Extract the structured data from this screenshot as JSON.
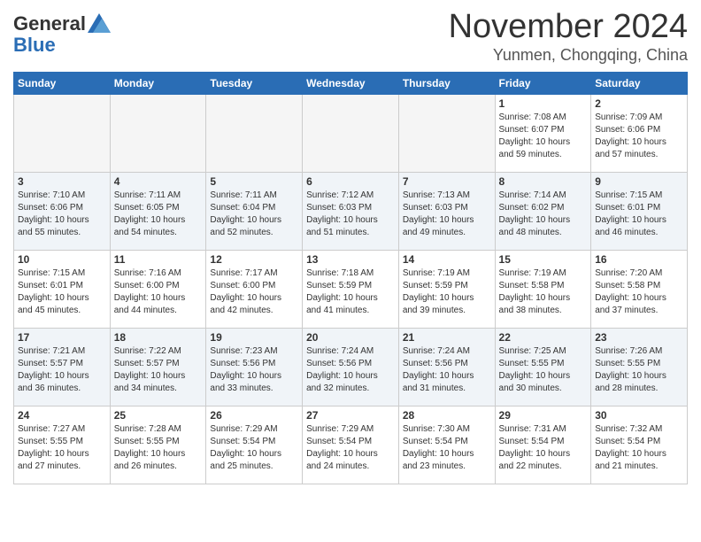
{
  "header": {
    "logo_general": "General",
    "logo_blue": "Blue",
    "month": "November 2024",
    "location": "Yunmen, Chongqing, China"
  },
  "weekdays": [
    "Sunday",
    "Monday",
    "Tuesday",
    "Wednesday",
    "Thursday",
    "Friday",
    "Saturday"
  ],
  "weeks": [
    [
      {
        "day": "",
        "info": ""
      },
      {
        "day": "",
        "info": ""
      },
      {
        "day": "",
        "info": ""
      },
      {
        "day": "",
        "info": ""
      },
      {
        "day": "",
        "info": ""
      },
      {
        "day": "1",
        "info": "Sunrise: 7:08 AM\nSunset: 6:07 PM\nDaylight: 10 hours\nand 59 minutes."
      },
      {
        "day": "2",
        "info": "Sunrise: 7:09 AM\nSunset: 6:06 PM\nDaylight: 10 hours\nand 57 minutes."
      }
    ],
    [
      {
        "day": "3",
        "info": "Sunrise: 7:10 AM\nSunset: 6:06 PM\nDaylight: 10 hours\nand 55 minutes."
      },
      {
        "day": "4",
        "info": "Sunrise: 7:11 AM\nSunset: 6:05 PM\nDaylight: 10 hours\nand 54 minutes."
      },
      {
        "day": "5",
        "info": "Sunrise: 7:11 AM\nSunset: 6:04 PM\nDaylight: 10 hours\nand 52 minutes."
      },
      {
        "day": "6",
        "info": "Sunrise: 7:12 AM\nSunset: 6:03 PM\nDaylight: 10 hours\nand 51 minutes."
      },
      {
        "day": "7",
        "info": "Sunrise: 7:13 AM\nSunset: 6:03 PM\nDaylight: 10 hours\nand 49 minutes."
      },
      {
        "day": "8",
        "info": "Sunrise: 7:14 AM\nSunset: 6:02 PM\nDaylight: 10 hours\nand 48 minutes."
      },
      {
        "day": "9",
        "info": "Sunrise: 7:15 AM\nSunset: 6:01 PM\nDaylight: 10 hours\nand 46 minutes."
      }
    ],
    [
      {
        "day": "10",
        "info": "Sunrise: 7:15 AM\nSunset: 6:01 PM\nDaylight: 10 hours\nand 45 minutes."
      },
      {
        "day": "11",
        "info": "Sunrise: 7:16 AM\nSunset: 6:00 PM\nDaylight: 10 hours\nand 44 minutes."
      },
      {
        "day": "12",
        "info": "Sunrise: 7:17 AM\nSunset: 6:00 PM\nDaylight: 10 hours\nand 42 minutes."
      },
      {
        "day": "13",
        "info": "Sunrise: 7:18 AM\nSunset: 5:59 PM\nDaylight: 10 hours\nand 41 minutes."
      },
      {
        "day": "14",
        "info": "Sunrise: 7:19 AM\nSunset: 5:59 PM\nDaylight: 10 hours\nand 39 minutes."
      },
      {
        "day": "15",
        "info": "Sunrise: 7:19 AM\nSunset: 5:58 PM\nDaylight: 10 hours\nand 38 minutes."
      },
      {
        "day": "16",
        "info": "Sunrise: 7:20 AM\nSunset: 5:58 PM\nDaylight: 10 hours\nand 37 minutes."
      }
    ],
    [
      {
        "day": "17",
        "info": "Sunrise: 7:21 AM\nSunset: 5:57 PM\nDaylight: 10 hours\nand 36 minutes."
      },
      {
        "day": "18",
        "info": "Sunrise: 7:22 AM\nSunset: 5:57 PM\nDaylight: 10 hours\nand 34 minutes."
      },
      {
        "day": "19",
        "info": "Sunrise: 7:23 AM\nSunset: 5:56 PM\nDaylight: 10 hours\nand 33 minutes."
      },
      {
        "day": "20",
        "info": "Sunrise: 7:24 AM\nSunset: 5:56 PM\nDaylight: 10 hours\nand 32 minutes."
      },
      {
        "day": "21",
        "info": "Sunrise: 7:24 AM\nSunset: 5:56 PM\nDaylight: 10 hours\nand 31 minutes."
      },
      {
        "day": "22",
        "info": "Sunrise: 7:25 AM\nSunset: 5:55 PM\nDaylight: 10 hours\nand 30 minutes."
      },
      {
        "day": "23",
        "info": "Sunrise: 7:26 AM\nSunset: 5:55 PM\nDaylight: 10 hours\nand 28 minutes."
      }
    ],
    [
      {
        "day": "24",
        "info": "Sunrise: 7:27 AM\nSunset: 5:55 PM\nDaylight: 10 hours\nand 27 minutes."
      },
      {
        "day": "25",
        "info": "Sunrise: 7:28 AM\nSunset: 5:55 PM\nDaylight: 10 hours\nand 26 minutes."
      },
      {
        "day": "26",
        "info": "Sunrise: 7:29 AM\nSunset: 5:54 PM\nDaylight: 10 hours\nand 25 minutes."
      },
      {
        "day": "27",
        "info": "Sunrise: 7:29 AM\nSunset: 5:54 PM\nDaylight: 10 hours\nand 24 minutes."
      },
      {
        "day": "28",
        "info": "Sunrise: 7:30 AM\nSunset: 5:54 PM\nDaylight: 10 hours\nand 23 minutes."
      },
      {
        "day": "29",
        "info": "Sunrise: 7:31 AM\nSunset: 5:54 PM\nDaylight: 10 hours\nand 22 minutes."
      },
      {
        "day": "30",
        "info": "Sunrise: 7:32 AM\nSunset: 5:54 PM\nDaylight: 10 hours\nand 21 minutes."
      }
    ]
  ]
}
